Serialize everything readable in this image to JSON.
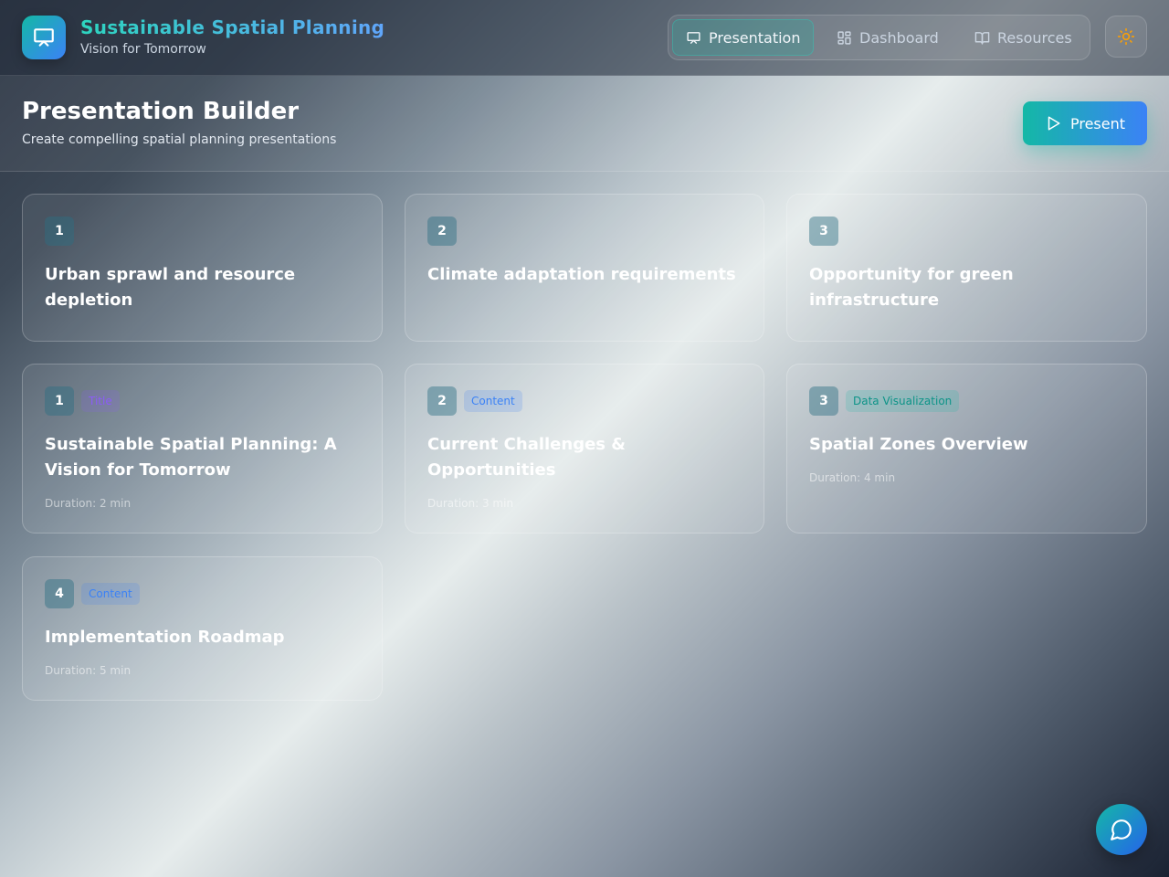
{
  "app": {
    "title": "Sustainable Spatial Planning",
    "subtitle": "Vision for Tomorrow",
    "logo_icon": "presentation-icon"
  },
  "nav": {
    "items": [
      {
        "label": "Presentation",
        "icon": "presentation-icon",
        "active": true
      },
      {
        "label": "Dashboard",
        "icon": "grid-icon",
        "active": false
      },
      {
        "label": "Resources",
        "icon": "book-icon",
        "active": false
      }
    ],
    "theme_icon": "sun-icon"
  },
  "page": {
    "title": "Presentation Builder",
    "subtitle": "Create compelling spatial planning presentations",
    "present_label": "Present"
  },
  "points": [
    {
      "number": "1",
      "text": "Urban sprawl and resource depletion"
    },
    {
      "number": "2",
      "text": "Climate adaptation requirements"
    },
    {
      "number": "3",
      "text": "Opportunity for green infrastructure"
    }
  ],
  "slides": [
    {
      "number": "1",
      "type": "Title",
      "title": "Sustainable Spatial Planning: A Vision for Tomorrow",
      "duration": "Duration: 2 min"
    },
    {
      "number": "2",
      "type": "Content",
      "title": "Current Challenges & Opportunities",
      "duration": "Duration: 3 min"
    },
    {
      "number": "3",
      "type": "Data Visualization",
      "title": "Spatial Zones Overview",
      "duration": "Duration: 4 min"
    },
    {
      "number": "4",
      "type": "Content",
      "title": "Implementation Roadmap",
      "duration": "Duration: 5 min"
    }
  ],
  "colors": {
    "accent_teal": "#14b8a6",
    "accent_blue": "#3b82f6",
    "tag_title": "#8b5cf6",
    "tag_content": "#3b82f6",
    "tag_data": "#14b8a6",
    "sun": "#f59e0b"
  },
  "chat_icon": "chat-icon"
}
